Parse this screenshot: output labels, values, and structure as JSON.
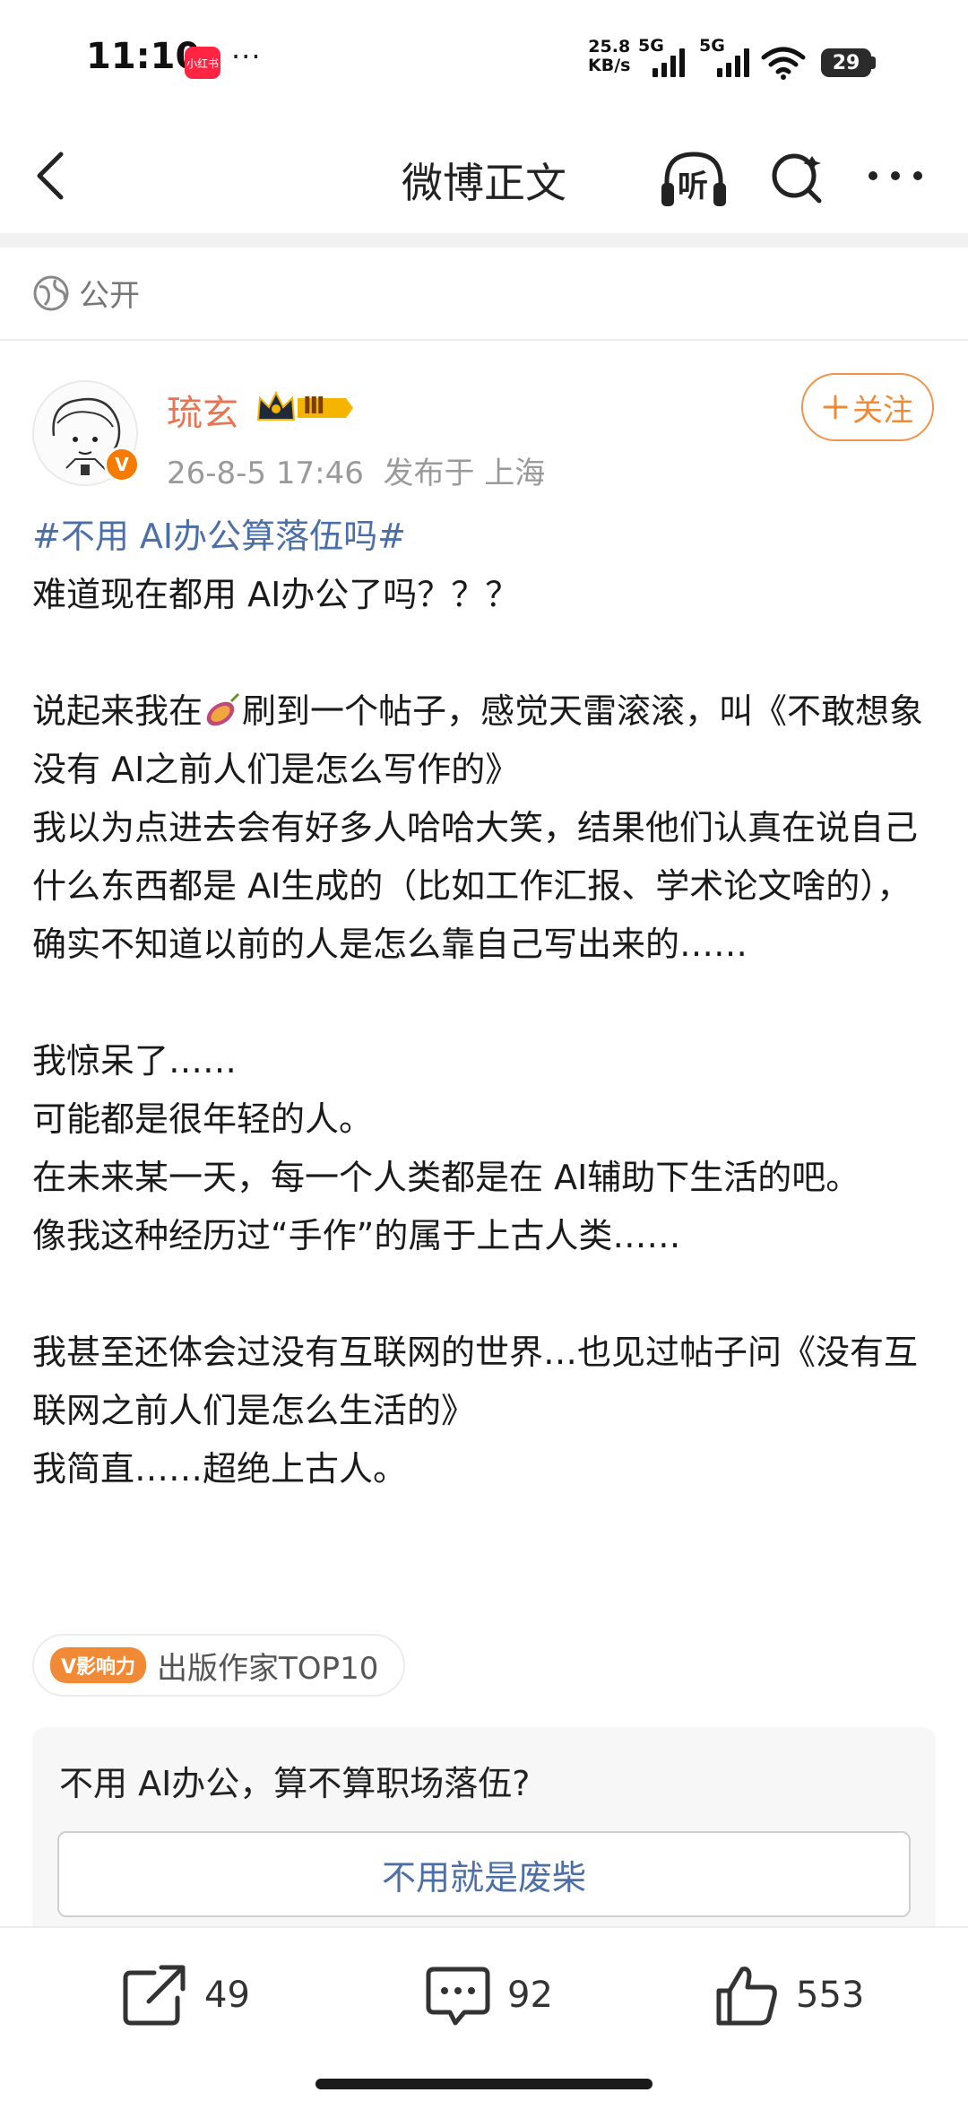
{
  "status_bar": {
    "time": "11:10",
    "app_badge": "小红书",
    "more": "···",
    "net_speed_value": "25.8",
    "net_speed_unit": "KB/s",
    "network1": "5G",
    "network2": "5G",
    "battery": "29"
  },
  "nav": {
    "title": "微博正文",
    "listen_label": "听"
  },
  "visibility": {
    "label": "公开"
  },
  "author": {
    "name": "琉玄",
    "vip_level": "Ⅲ",
    "time": "26-8-5 17:46",
    "location": "发布于 上海",
    "follow_label": "关注"
  },
  "post": {
    "topic": "#不用 AI办公算落伍吗#",
    "line1": "难道现在都用 AI办公了吗？？？",
    "para2_before": "说起来我在",
    "para2_after": "刷到一个帖子，感觉天雷滚滚，叫《不敢想象没有 AI之前人们是怎么写作的》",
    "para3": "我以为点进去会有好多人哈哈大笑，结果他们认真在说自己什么东西都是 AI生成的（比如工作汇报、学术论文啥的），确实不知道以前的人是怎么靠自己写出来的……",
    "para4": "我惊呆了……",
    "para5": "可能都是很年轻的人。",
    "para6": "在未来某一天，每一个人类都是在 AI辅助下生活的吧。",
    "para7": "像我这种经历过“手作”的属于上古人类……",
    "para8": "我甚至还体会过没有互联网的世界…也见过帖子问《没有互联网之前人们是怎么生活的》",
    "para9": "我简直……超绝上古人。"
  },
  "influence": {
    "badge": "V影响力",
    "label": "出版作家TOP10"
  },
  "poll": {
    "question": "不用 AI办公，算不算职场落伍?",
    "option1": "不用就是废柴"
  },
  "actions": {
    "share_count": "49",
    "comment_count": "92",
    "like_count": "553"
  },
  "colors": {
    "accent_orange": "#f08a36",
    "link_blue": "#4b6fa6",
    "name_orange": "#eb7350"
  }
}
